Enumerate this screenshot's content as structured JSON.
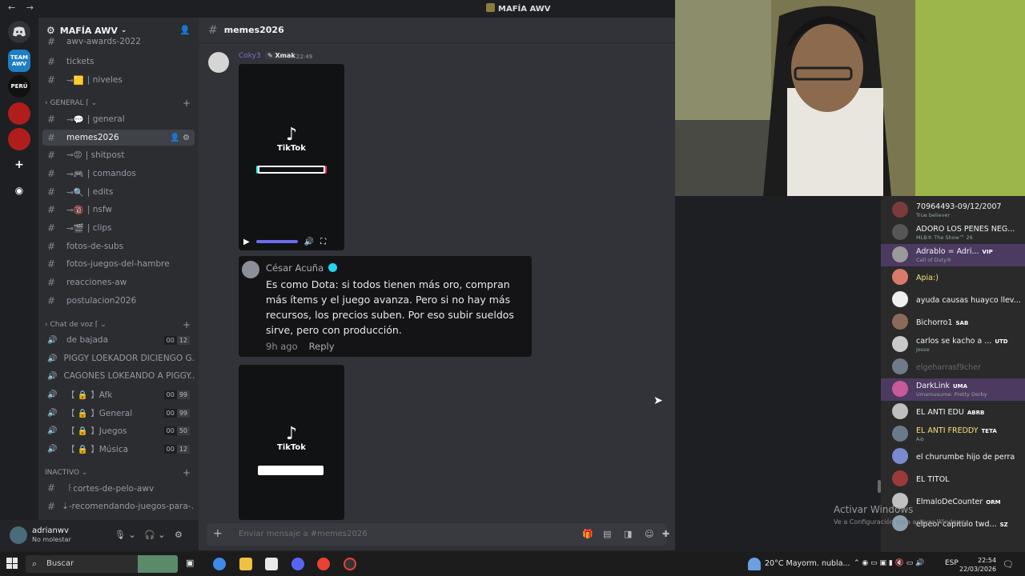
{
  "titlebar": {
    "title": "MAFÍA AWV",
    "back": "←",
    "forward": "→"
  },
  "server": {
    "name": "MAFÍA AWV"
  },
  "channels": {
    "top_partial": "awv-awards-2022",
    "tickets": "tickets",
    "niveles": "| niveles",
    "cat_general": "GENERAL",
    "general": "| general",
    "memes": "memes2026",
    "shitpost": "| shitpost",
    "comandos": "| comandos",
    "edits": "| edits",
    "nsfw": "| nsfw",
    "clips": "| clips",
    "fotos_subs": "fotos-de-subs",
    "fotos_juegos": "fotos-juegos-del-hambre",
    "reacciones": "reacciones-aw",
    "postulacion": "postulacion2026",
    "cat_voz": "Chat de voz",
    "voice": [
      {
        "label": "de bajada",
        "a": "00",
        "b": "12"
      },
      {
        "label": "PIGGY LOEKADOR DICIENGO G...",
        "a": "",
        "b": ""
      },
      {
        "label": "CAGONES LOKEANDO A PIGGY...",
        "a": "",
        "b": ""
      },
      {
        "label": "【 🔒 】Afk",
        "a": "00",
        "b": "99"
      },
      {
        "label": "【 🔒 】General",
        "a": "00",
        "b": "99"
      },
      {
        "label": "【 🔒 】Juegos",
        "a": "00",
        "b": "50"
      },
      {
        "label": "【 🔒 】Música",
        "a": "00",
        "b": "12"
      }
    ],
    "cat_inactivo": "INACTIVO",
    "cortes": "꒰cortes-de-pelo-awv",
    "recomendando": "⇣-recomendando-juegos-para-..."
  },
  "user": {
    "name": "adrianwv",
    "status": "No molestar"
  },
  "chat": {
    "channel": "memes2026",
    "author": "Coky3",
    "badge": "Xmak",
    "time": "22:49",
    "tiktok_word": "TikTok",
    "comment_name": "César Acuña",
    "comment_text": "Es como Dota: si todos tienen más oro, compran más ítems y el juego avanza. Pero si no hay más recursos, los precios suben. Por eso subir sueldos sirve, pero con producción.",
    "comment_age": "9h ago",
    "comment_reply": "Reply",
    "placeholder": "Enviar mensaje a #memes2026"
  },
  "stream_chat": [
    {
      "name": "70964493-09/12/2007",
      "sub": "True believer",
      "tag": "",
      "color": "#7a3b3b",
      "namecolor": "#f2f3f5"
    },
    {
      "name": "ADORO LOS PENES NEG...",
      "sub": "MLB® The Show™ 26",
      "tag": "",
      "color": "#555555",
      "namecolor": "#f2f3f5"
    },
    {
      "name": "Adrablo = Adri...",
      "sub": "Call of Duty®",
      "tag": "VIP",
      "color": "#9a9a9a",
      "namecolor": "#f2f3f5"
    },
    {
      "name": "Apia:)",
      "sub": "",
      "tag": "",
      "color": "#d97a6a",
      "namecolor": "#f5e27a"
    },
    {
      "name": "ayuda causas huayco llev...",
      "sub": "",
      "tag": "",
      "color": "#f0f0f0",
      "namecolor": "#f2f3f5"
    },
    {
      "name": "Bichorro1",
      "sub": "",
      "tag": "SAB",
      "color": "#8a6a5a",
      "namecolor": "#f2f3f5"
    },
    {
      "name": "carlos se kacho a ...",
      "sub": "Jesse",
      "tag": "UTD",
      "color": "#c9c9c9",
      "namecolor": "#f2f3f5"
    },
    {
      "name": "elgeharrasf9cher",
      "sub": "",
      "tag": "",
      "color": "#707a8a",
      "namecolor": "#6a6a6a"
    },
    {
      "name": "DarkLink",
      "sub": "Umamusume: Pretty Derby",
      "tag": "UMA",
      "color": "#c85a9a",
      "namecolor": "#f2f3f5"
    },
    {
      "name": "EL ANTI EDU",
      "sub": "",
      "tag": "ABRB",
      "color": "#bfbfbf",
      "namecolor": "#f2f3f5"
    },
    {
      "name": "EL ANTI FREDDY",
      "sub": "A⊘",
      "tag": "TETA",
      "color": "#6a7a8a",
      "namecolor": "#f5e27a"
    },
    {
      "name": "el churumbe hijo de perra",
      "sub": "",
      "tag": "",
      "color": "#7a8ad0",
      "namecolor": "#f2f3f5"
    },
    {
      "name": "EL TITOL",
      "sub": "",
      "tag": "",
      "color": "#9a3a3a",
      "namecolor": "#f2f3f5"
    },
    {
      "name": "ElmaloDeCounter",
      "sub": "",
      "tag": "ORM",
      "color": "#c0c0c0",
      "namecolor": "#f2f3f5"
    },
    {
      "name": "elpeor capitulo twd...",
      "sub": "",
      "tag": "SZ",
      "color": "#8aa0b0",
      "namecolor": "#f2f3f5"
    }
  ],
  "windows_activation": {
    "title": "Activar Windows",
    "sub": "Ve a Configuración para activar Windows."
  },
  "taskbar": {
    "search": "Buscar",
    "weather": "20°C  Mayorm. nubla...",
    "lang": "ESP",
    "time": "22:54",
    "date": "22/03/2026"
  },
  "colors": {
    "accent": "#5865f2",
    "bg": "#313338",
    "sidebar": "#2b2d31"
  }
}
